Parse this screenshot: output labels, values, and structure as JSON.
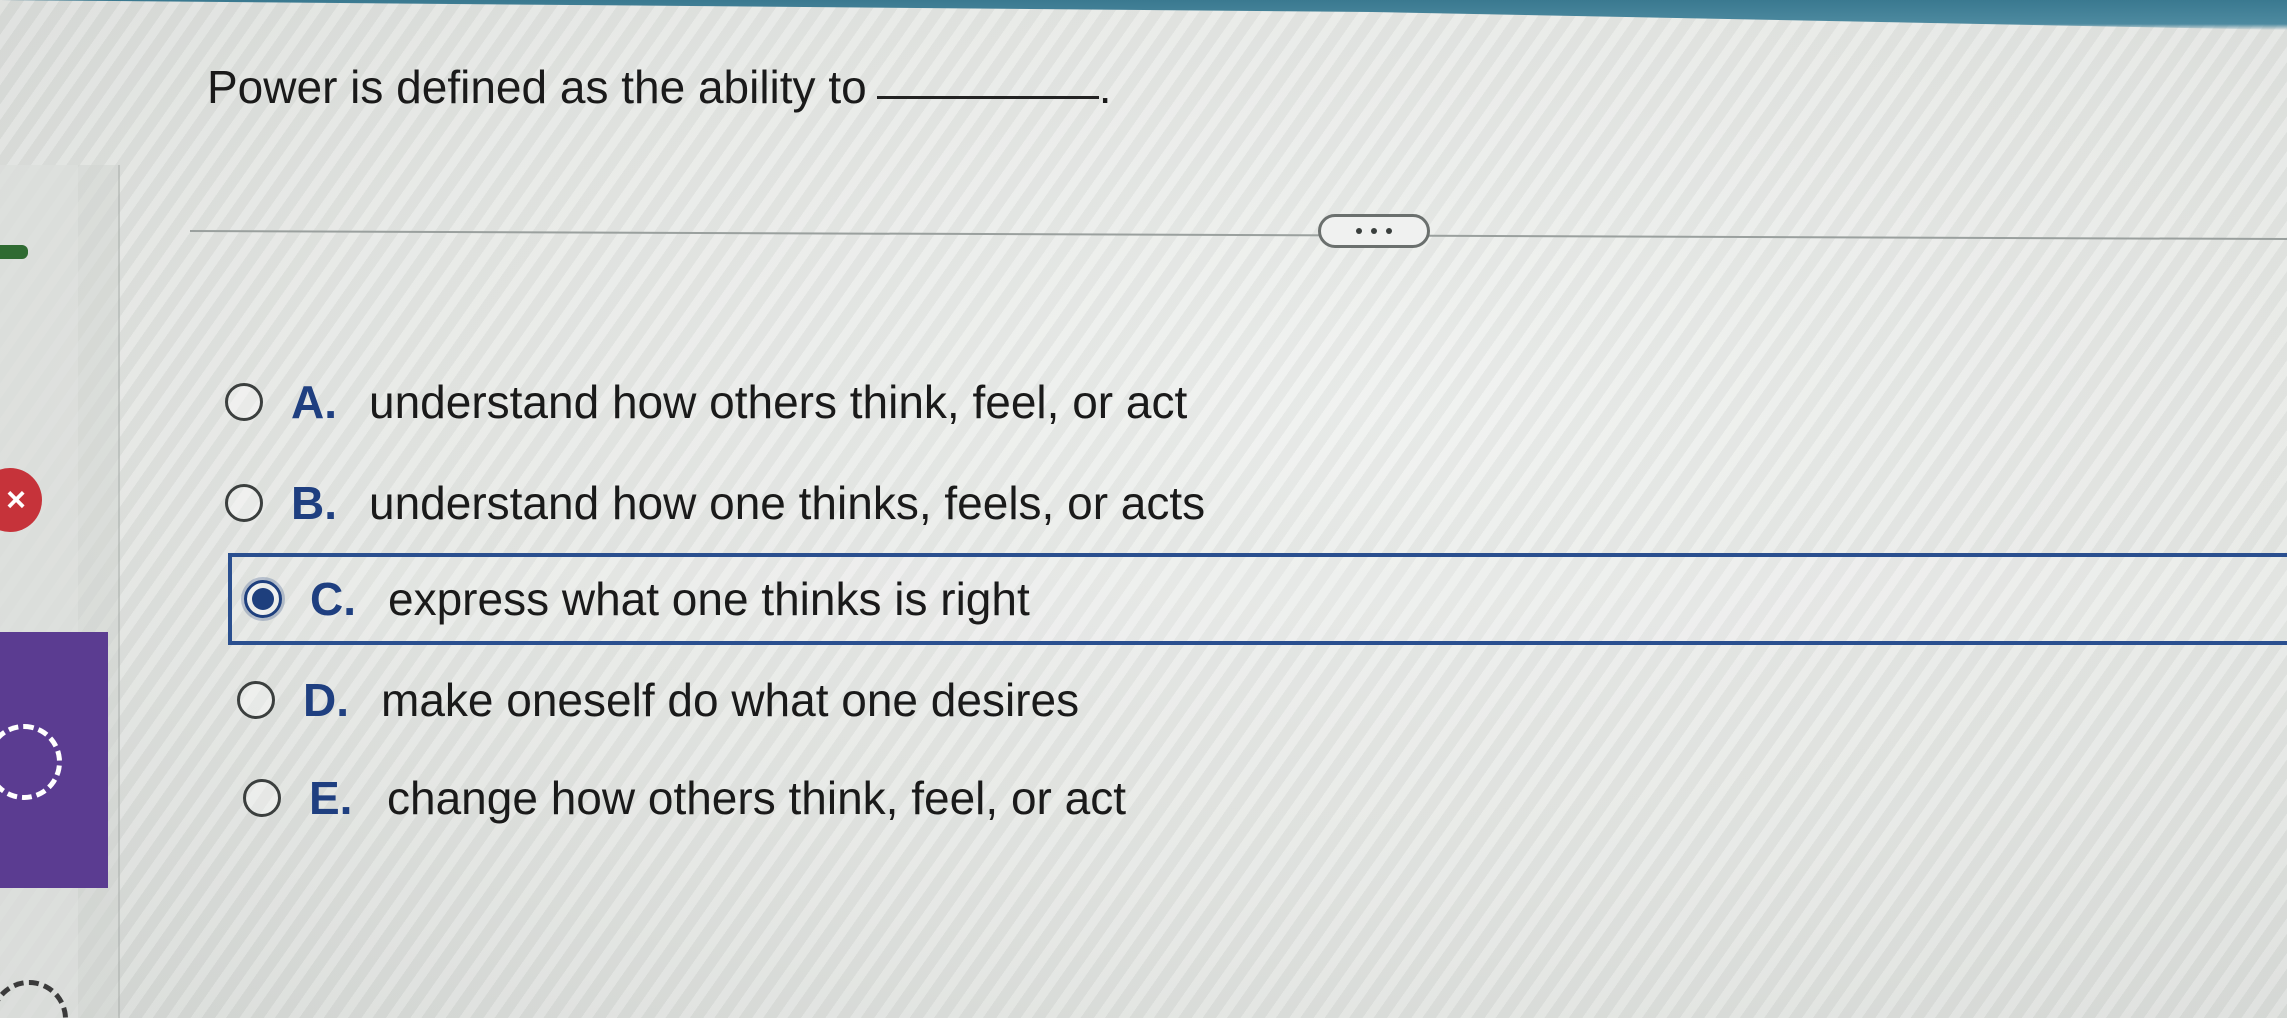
{
  "question": {
    "text": "Power is defined as the ability to",
    "end_punct": "."
  },
  "more_button": {
    "icon": "ellipsis-icon"
  },
  "options": [
    {
      "letter": "A.",
      "text": "understand how others think, feel, or act",
      "selected": false
    },
    {
      "letter": "B.",
      "text": "understand how one thinks, feels, or acts",
      "selected": false
    },
    {
      "letter": "C.",
      "text": "express what one thinks is right",
      "selected": true
    },
    {
      "letter": "D.",
      "text": "make oneself do what one desires",
      "selected": false
    },
    {
      "letter": "E.",
      "text": "change how others think, feel, or act",
      "selected": false
    }
  ],
  "sidebar": {
    "status_icon": "incorrect-x-icon",
    "status_mark": "×",
    "progress_icon": "progress-ring-icon"
  },
  "colors": {
    "accent": "#1f3f80",
    "selection_border": "#2a4f8f",
    "incorrect": "#c6333a",
    "purple_tile": "#5b3c91",
    "top_bar": "#3a7990"
  }
}
